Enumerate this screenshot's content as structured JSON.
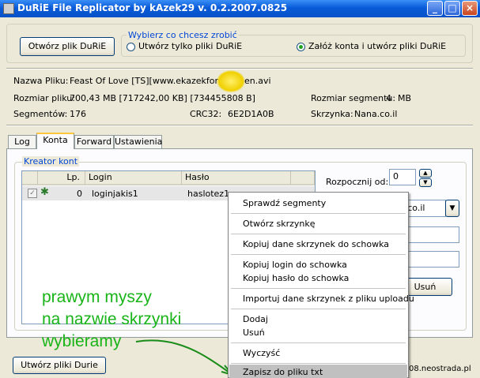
{
  "window": {
    "title": "DuRiE File Replicator by kAzek29 v. 0.2.2007.0825"
  },
  "top": {
    "open_button": "Otwórz plik DuRiE",
    "choice_legend": "Wybierz co chcesz zrobić",
    "radio_only_files": "Utwórz tylko pliki DuRiE",
    "radio_accounts": "Załóż konta i utwórz pliki DuRiE",
    "selected": "radio_accounts"
  },
  "info": {
    "file_name_label": "Nazwa Pliku:",
    "file_name_value": "Feast Of Love [TS][www.ekazekforum.",
    "file_name_tail": "en.avi",
    "file_size_label": "Rozmiar pliku:",
    "file_size_value": "700,43 MB [717242,00 KB] [734455808 B]",
    "segment_size_label": "Rozmiar segmentu:",
    "segment_size_value": "4",
    "segment_size_unit": "MB",
    "segments_label": "Segmentów:",
    "segments_value": "176",
    "crc_label": "CRC32:",
    "crc_value": "6E2D1A0B",
    "mailbox_label": "Skrzynka:",
    "mailbox_value": "Nana.co.il"
  },
  "tabs": [
    "Log",
    "Konta",
    "Forward",
    "Ustawienia"
  ],
  "active_tab": "Konta",
  "creator": {
    "legend": "Kreator kont",
    "columns": [
      "Lp.",
      "Login",
      "Hasło"
    ],
    "rows": [
      {
        "lp": "0",
        "login": "loginjakis1",
        "password": "haslotez1",
        "checked": true
      }
    ],
    "start_from_label": "Rozpocznij od:",
    "start_from_value": "0",
    "domain_value": "a.co.il",
    "remove_button": "Usuń"
  },
  "context_menu": [
    "Sprawdź segmenty",
    "Otwórz skrzynkę",
    "Kopiuj dane skrzynek do schowka",
    "Kopiuj login do schowka",
    "Kopiuj hasło do schowka",
    "Importuj dane skrzynek z pliku uploadu",
    "Dodaj",
    "Usuń",
    "Wyczyść",
    "Zapisz do pliku txt"
  ],
  "annotation": [
    "prawym myszy",
    "na nazwie skrzynki",
    "wybieramy"
  ],
  "bottom": {
    "create_button": "Utwórz pliki Durie",
    "status_text": "08.neostrada.pl"
  },
  "colors": {
    "title_bar": "#0a5bd8",
    "group_label": "#0046d5",
    "annotation": "#18b418",
    "menu_highlight": "#c0c0c0"
  }
}
